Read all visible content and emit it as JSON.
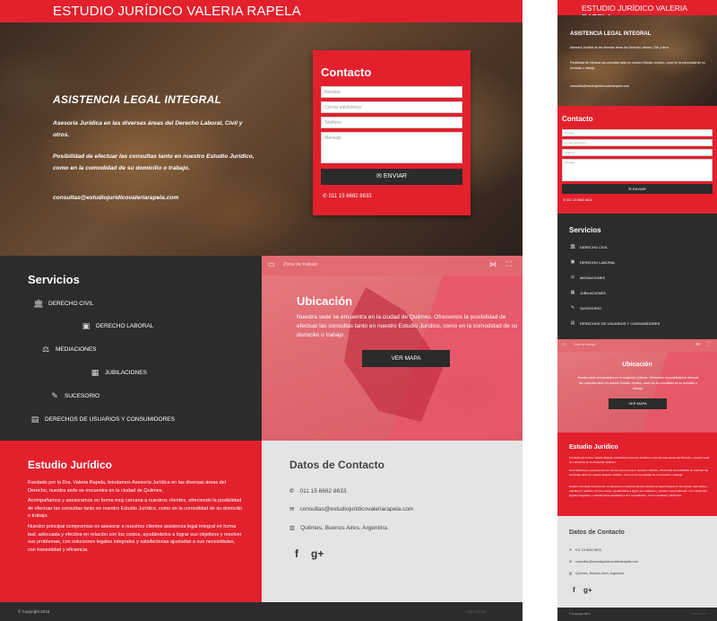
{
  "site": {
    "brand": "ESTUDIO JURÍDICO VALERIA RAPELA"
  },
  "hero": {
    "title": "ASISTENCIA LEGAL INTEGRAL",
    "p1": "Asesoría Jurídica en las diversas áreas del Derecho Laboral, Civil y otros.",
    "p2": "Posibilidad de efectuar las consultas tanto en nuestro Estudio Jurídico, como en la comodidad de su domicilio o trabajo.",
    "email": "consultas@estudiojuridicovaleriarapela.com"
  },
  "contact": {
    "title": "Contacto",
    "placeholders": {
      "name": "Nombre",
      "email": "Correo electrónico",
      "phone": "Teléfono",
      "message": "Mensaje"
    },
    "send_label": "ENVIAR",
    "phone": "011 15 6682 8633"
  },
  "services": {
    "title": "Servicios",
    "items": [
      {
        "label": "DERECHO CIVIL",
        "icon": "bank-icon"
      },
      {
        "label": "DERECHO LABORAL",
        "icon": "briefcase-icon"
      },
      {
        "label": "MEDIACIONES",
        "icon": "scales-icon"
      },
      {
        "label": "JUBILACIONES",
        "icon": "building-icon"
      },
      {
        "label": "SUCESORIO",
        "icon": "document-icon"
      },
      {
        "label": "DERECHOS DE USUARIOS Y CONSUMIDORES",
        "icon": "cubes-icon"
      }
    ]
  },
  "map": {
    "bar_label": "Zona de trabajo",
    "title": "Ubicación",
    "text": "Nuestra sede se encuentra en la ciudad de Quilmes. Ofrecemos la posibilidad de efectuar las consultas tanto en nuestro Estudio Jurídico, como en la comodidad de su domicilio o trabajo.",
    "button_label": "VER MAPA"
  },
  "about": {
    "title": "Estudio Jurídico",
    "p1": "Fundado por la Dra. Valeria Rapela, brindamos Asesoría Jurídica en las diversas áreas del Derecho, nuestra sede se encuentra en la ciudad de Quilmes.",
    "p2": "Acompañamos y asesoramos en forma muy cercana a nuestros clientes, ofreciendo la posibilidad de efectuar las consultas tanto en nuestro Estudio Jurídico, como en la comodidad de su domicilio o trabajo.",
    "p3": "Nuestro principal compromiso es asesorar a nuestros clientes asistencia legal integral en forma leal, adecuada y efectiva en relación con los costos, ayudándolos a lograr sus objetivos y resolver sus problemas, con soluciones legales integrales y satisfactorias ajustadas a sus necesidades, con honestidad y eficiencia."
  },
  "datos": {
    "title": "Datos de Contacto",
    "phone": "011 15 6682 8633",
    "email": "consultas@estudiojuridicovaleriarapela.com",
    "address": "Quilmes, Buenos Aires, Argentina.",
    "facebook": "f",
    "googleplus": "g+"
  },
  "footer": {
    "copyright": "© Copyright 2016",
    "credit": "Laboratorio"
  },
  "colors": {
    "primary": "#e2212d",
    "dark": "#2c2c2c",
    "light": "#e4e4e4"
  }
}
